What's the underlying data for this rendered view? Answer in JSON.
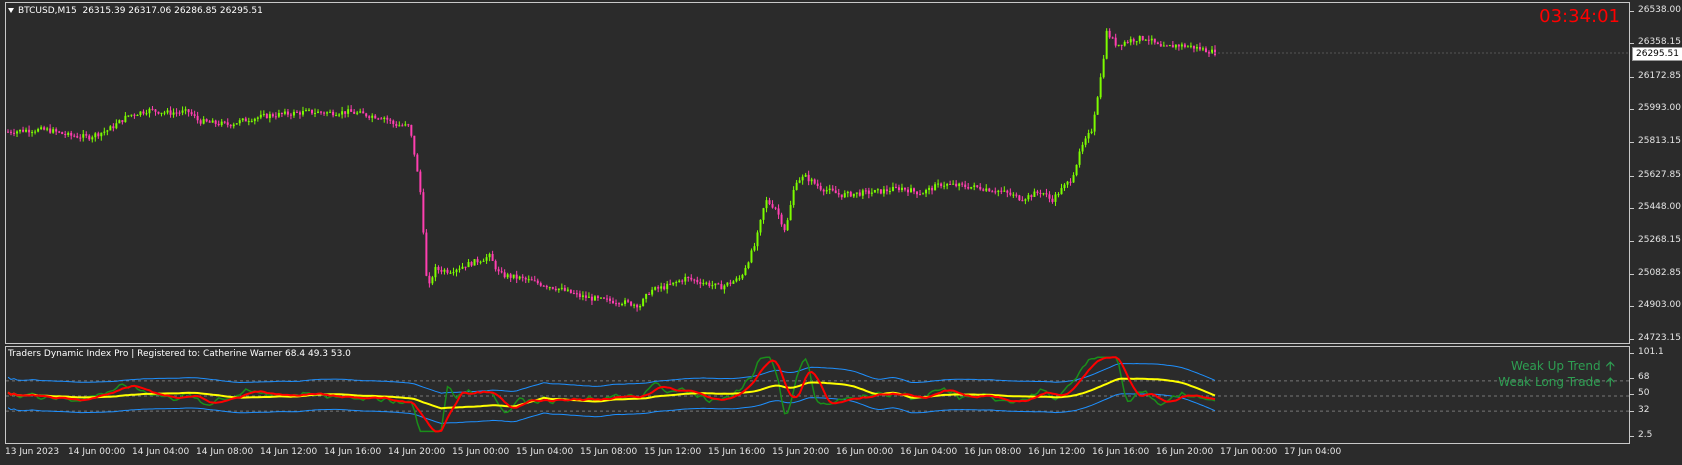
{
  "header": {
    "symbol": "BTCUSD,M15",
    "ohlc": "26315.39 26317.06 26286.85 26295.51"
  },
  "countdown": "03:34:01",
  "current_price_tag": "26295.51",
  "price_scale": [
    "26538.00",
    "26358.15",
    "26172.85",
    "25993.00",
    "25813.15",
    "25627.85",
    "25448.00",
    "25268.15",
    "25082.85",
    "24903.00",
    "24723.15"
  ],
  "indicator": {
    "title": "Traders Dynamic Index Pro | Registered to: Catherine Warner 68.4 49.3 53.0",
    "scale": [
      "101.1",
      "68",
      "50",
      "32",
      "2.5"
    ],
    "signals": [
      {
        "text": "Weak Up  Trend"
      },
      {
        "text": "Weak Long  Trade"
      }
    ]
  },
  "time_axis": [
    "13 Jun 2023",
    "14 Jun 00:00",
    "14 Jun 04:00",
    "14 Jun 08:00",
    "14 Jun 12:00",
    "14 Jun 16:00",
    "14 Jun 20:00",
    "15 Jun 00:00",
    "15 Jun 04:00",
    "15 Jun 08:00",
    "15 Jun 12:00",
    "15 Jun 16:00",
    "15 Jun 20:00",
    "16 Jun 00:00",
    "16 Jun 04:00",
    "16 Jun 08:00",
    "16 Jun 12:00",
    "16 Jun 16:00",
    "16 Jun 20:00",
    "17 Jun 00:00",
    "17 Jun 04:00"
  ],
  "colors": {
    "bull": "#7cfc00",
    "bear": "#ff3fb0",
    "countdown": "#ff0000",
    "signal": "#2e9e52",
    "tdi_red": "#ff0000",
    "tdi_green": "#1a8f1a",
    "tdi_yellow": "#ffff00",
    "tdi_bands": "#1e90ff"
  },
  "chart_data": {
    "type": "candlestick",
    "ylim": [
      24723.15,
      26538.0
    ],
    "close_path": [
      [
        0,
        25870
      ],
      [
        20,
        25880
      ],
      [
        40,
        25880
      ],
      [
        60,
        25850
      ],
      [
        80,
        25840
      ],
      [
        100,
        25880
      ],
      [
        120,
        25960
      ],
      [
        140,
        25990
      ],
      [
        160,
        25975
      ],
      [
        180,
        25980
      ],
      [
        190,
        25930
      ],
      [
        200,
        25920
      ],
      [
        220,
        25910
      ],
      [
        240,
        25940
      ],
      [
        260,
        25960
      ],
      [
        280,
        25970
      ],
      [
        300,
        25980
      ],
      [
        320,
        25975
      ],
      [
        340,
        25980
      ],
      [
        360,
        25960
      ],
      [
        375,
        25950
      ],
      [
        385,
        25910
      ],
      [
        400,
        25900
      ],
      [
        405,
        25750
      ],
      [
        412,
        25500
      ],
      [
        418,
        24980
      ],
      [
        425,
        25110
      ],
      [
        440,
        25100
      ],
      [
        460,
        25140
      ],
      [
        480,
        25180
      ],
      [
        490,
        25080
      ],
      [
        510,
        25060
      ],
      [
        530,
        25030
      ],
      [
        550,
        25000
      ],
      [
        570,
        24960
      ],
      [
        590,
        24940
      ],
      [
        610,
        24930
      ],
      [
        630,
        24910
      ],
      [
        640,
        24990
      ],
      [
        660,
        25020
      ],
      [
        675,
        25060
      ],
      [
        690,
        25040
      ],
      [
        710,
        25010
      ],
      [
        730,
        25060
      ],
      [
        745,
        25250
      ],
      [
        755,
        25490
      ],
      [
        765,
        25450
      ],
      [
        775,
        25320
      ],
      [
        785,
        25600
      ],
      [
        795,
        25620
      ],
      [
        810,
        25560
      ],
      [
        830,
        25520
      ],
      [
        850,
        25530
      ],
      [
        870,
        25540
      ],
      [
        890,
        25560
      ],
      [
        910,
        25530
      ],
      [
        930,
        25580
      ],
      [
        950,
        25570
      ],
      [
        970,
        25560
      ],
      [
        990,
        25540
      ],
      [
        1010,
        25500
      ],
      [
        1030,
        25540
      ],
      [
        1040,
        25490
      ],
      [
        1050,
        25550
      ],
      [
        1060,
        25610
      ],
      [
        1070,
        25780
      ],
      [
        1080,
        25880
      ],
      [
        1090,
        26200
      ],
      [
        1095,
        26420
      ],
      [
        1105,
        26350
      ],
      [
        1120,
        26380
      ],
      [
        1135,
        26390
      ],
      [
        1150,
        26330
      ],
      [
        1165,
        26350
      ],
      [
        1180,
        26340
      ],
      [
        1195,
        26320
      ],
      [
        1210,
        26300
      ]
    ]
  }
}
